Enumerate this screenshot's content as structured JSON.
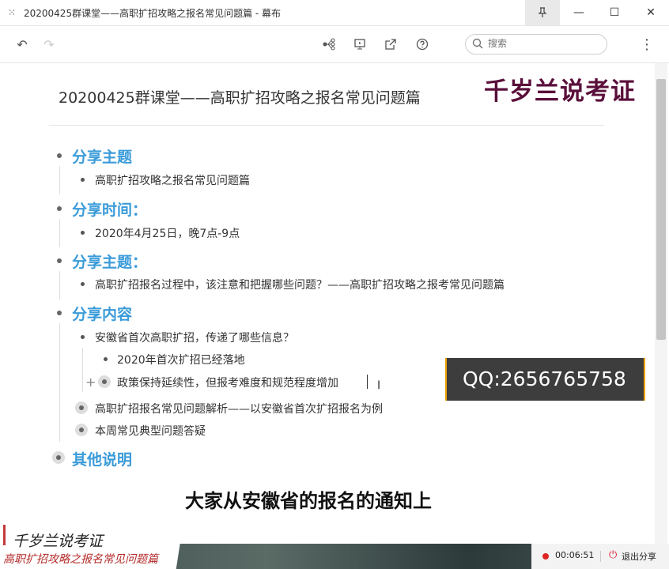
{
  "window": {
    "title": "20200425群课堂——高职扩招攻略之报名常见问题篇 - 幕布",
    "pin_icon": "pin-icon",
    "min_glyph": "—",
    "max_glyph": "☐",
    "close_glyph": "✕"
  },
  "toolbar": {
    "undo_glyph": "↶",
    "redo_glyph": "↷",
    "search_placeholder": "搜索",
    "menu_glyph": "⋮"
  },
  "doc": {
    "title": "20200425群课堂——高职扩招攻略之报名常见问题篇",
    "watermark": "千岁兰说考证",
    "sections": [
      {
        "heading": "分享主题",
        "items": [
          "高职扩招攻略之报名常见问题篇"
        ]
      },
      {
        "heading": "分享时间：",
        "items": [
          "2020年4月25日，晚7点-9点"
        ]
      },
      {
        "heading": "分享主题：",
        "items": [
          "高职扩招报名过程中，该注意和把握哪些问题？——高职扩招攻略之报考常见问题篇"
        ]
      },
      {
        "heading": "分享内容",
        "items": [
          "安徽省首次高职扩招，传递了哪些信息？",
          "高职扩招报名常见问题解析——以安徽省首次扩招报名为例",
          "本周常见典型问题答疑"
        ],
        "subitems": [
          "2020年首次扩招已经落地",
          "政策保持延续性，但报考难度和规范程度增加"
        ]
      },
      {
        "heading": "其他说明"
      }
    ]
  },
  "overlay": {
    "qq": "QQ:2656765758",
    "subtitle": "大家从安徽省的报名的通知上",
    "brand_name": "千岁兰说考证",
    "brand_sub": "高职扩招攻略之报名常见问题篇"
  },
  "recording": {
    "time": "00:06:51",
    "exit_label": "退出分享"
  },
  "colors": {
    "heading": "#3a9bd9",
    "watermark": "#5a0f3a",
    "qq_border": "#f2a100",
    "rec": "#e02424"
  }
}
